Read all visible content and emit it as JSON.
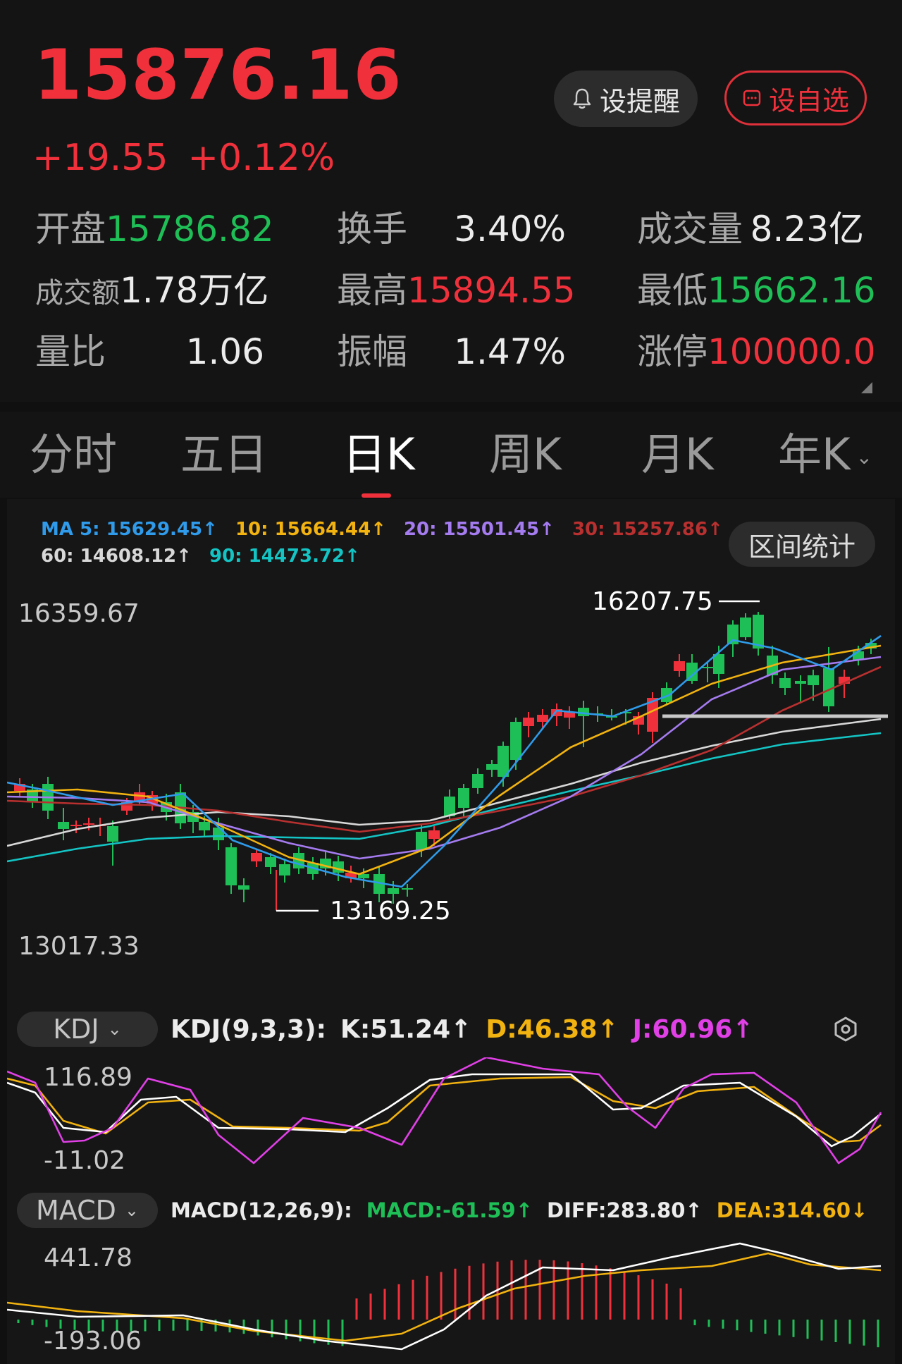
{
  "quote": {
    "price": "15876.16",
    "change": "+19.55",
    "change_pct": "+0.12%",
    "remind_label": "设提醒",
    "watch_label": "设自选"
  },
  "stats": [
    {
      "label": "开盘",
      "value": "15786.82",
      "color": "#1fbf57"
    },
    {
      "label": "换手",
      "value": "3.40%",
      "color": "#ececec"
    },
    {
      "label": "成交量",
      "value": "8.23亿",
      "color": "#ececec"
    },
    {
      "label": "成交额",
      "value": "1.78万亿",
      "color": "#ececec"
    },
    {
      "label": "最高",
      "value": "15894.55",
      "color": "#f0313c"
    },
    {
      "label": "最低",
      "value": "15662.16",
      "color": "#1fbf57"
    },
    {
      "label": "量比",
      "value": "1.06",
      "color": "#ececec"
    },
    {
      "label": "振幅",
      "value": "1.47%",
      "color": "#ececec"
    },
    {
      "label": "涨停",
      "value": "100000.0",
      "color": "#f0313c"
    }
  ],
  "tabs": [
    "分时",
    "五日",
    "日K",
    "周K",
    "月K",
    "年K"
  ],
  "active_tab": "日K",
  "ma": {
    "ma5": "MA 5: 15629.45↑",
    "ma10": "10: 15664.44↑",
    "ma20": "20: 15501.45↑",
    "ma30": "30: 15257.86↑",
    "ma60": "60: 14608.12↑",
    "ma90": "90: 14473.72↑",
    "colors": {
      "ma5": "#2f9bea",
      "ma10": "#f2b311",
      "ma20": "#a57bf0",
      "ma30": "#b8302f",
      "ma60": "#d8d8d8",
      "ma90": "#14c4c4"
    }
  },
  "range_label": "区间统计",
  "kline": {
    "y_max_label": "16359.67",
    "y_min_label": "13017.33",
    "high_label": "16207.75",
    "low_label": "13169.25"
  },
  "kdj": {
    "selector": "KDJ",
    "params": "KDJ(9,3,3):",
    "k": "K:51.24↑",
    "d": "D:46.38↑",
    "j": "J:60.96↑",
    "y_max": "116.89",
    "y_min": "-11.02"
  },
  "macd": {
    "selector": "MACD",
    "params": "MACD(12,26,9):",
    "macd": "MACD:-61.59↑",
    "diff": "DIFF:283.80↑",
    "dea": "DEA:314.60↓",
    "y_max": "441.78",
    "y_min": "-193.06"
  }
}
